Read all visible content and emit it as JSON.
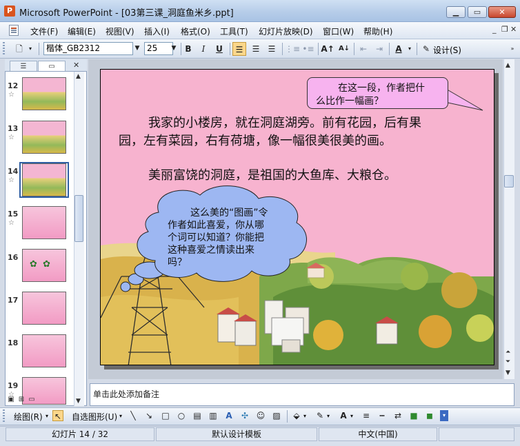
{
  "window": {
    "title": "Microsoft PowerPoint - [03第三课_洞庭鱼米乡.ppt]",
    "app_icon_letter": "P"
  },
  "menu": [
    "文件(F)",
    "编辑(E)",
    "视图(V)",
    "插入(I)",
    "格式(O)",
    "工具(T)",
    "幻灯片放映(D)",
    "窗口(W)",
    "帮助(H)"
  ],
  "toolbar": {
    "font_name": "楷体_GB2312",
    "font_size": "25",
    "bold": "B",
    "italic": "I",
    "underline": "U",
    "design_label": "设计(S)"
  },
  "slides_pane": {
    "thumbs": [
      {
        "num": "12",
        "star": "☆"
      },
      {
        "num": "13",
        "star": "☆"
      },
      {
        "num": "14",
        "star": "☆"
      },
      {
        "num": "15",
        "star": "☆"
      },
      {
        "num": "16",
        "star": ""
      },
      {
        "num": "17",
        "star": ""
      },
      {
        "num": "18",
        "star": ""
      },
      {
        "num": "19",
        "star": "☆"
      }
    ]
  },
  "slide": {
    "callout": [
      "在这一段，作者把什",
      "么比作一幅画？"
    ],
    "para1_line1": "我家的小楼房，就在洞庭湖旁。前有花园，后有果",
    "para1_line2": "园，左有菜园，右有荷塘，像一幅很美很美的画。",
    "para2": "美丽富饶的洞庭，是祖国的大鱼库、大粮仓。",
    "cloud": [
      "这么美的“图画”令",
      "作者如此喜爱，你从哪",
      "个词可以知道？你能把",
      "这种喜爱之情读出来",
      "吗？"
    ]
  },
  "notes": {
    "placeholder": "单击此处添加备注"
  },
  "drawing_toolbar": {
    "draw_label": "绘图(R)",
    "autoshapes_label": "自选图形(U)"
  },
  "status": {
    "slide_info": "幻灯片 14 / 32",
    "template": "默认设计模板",
    "language": "中文(中国)"
  }
}
